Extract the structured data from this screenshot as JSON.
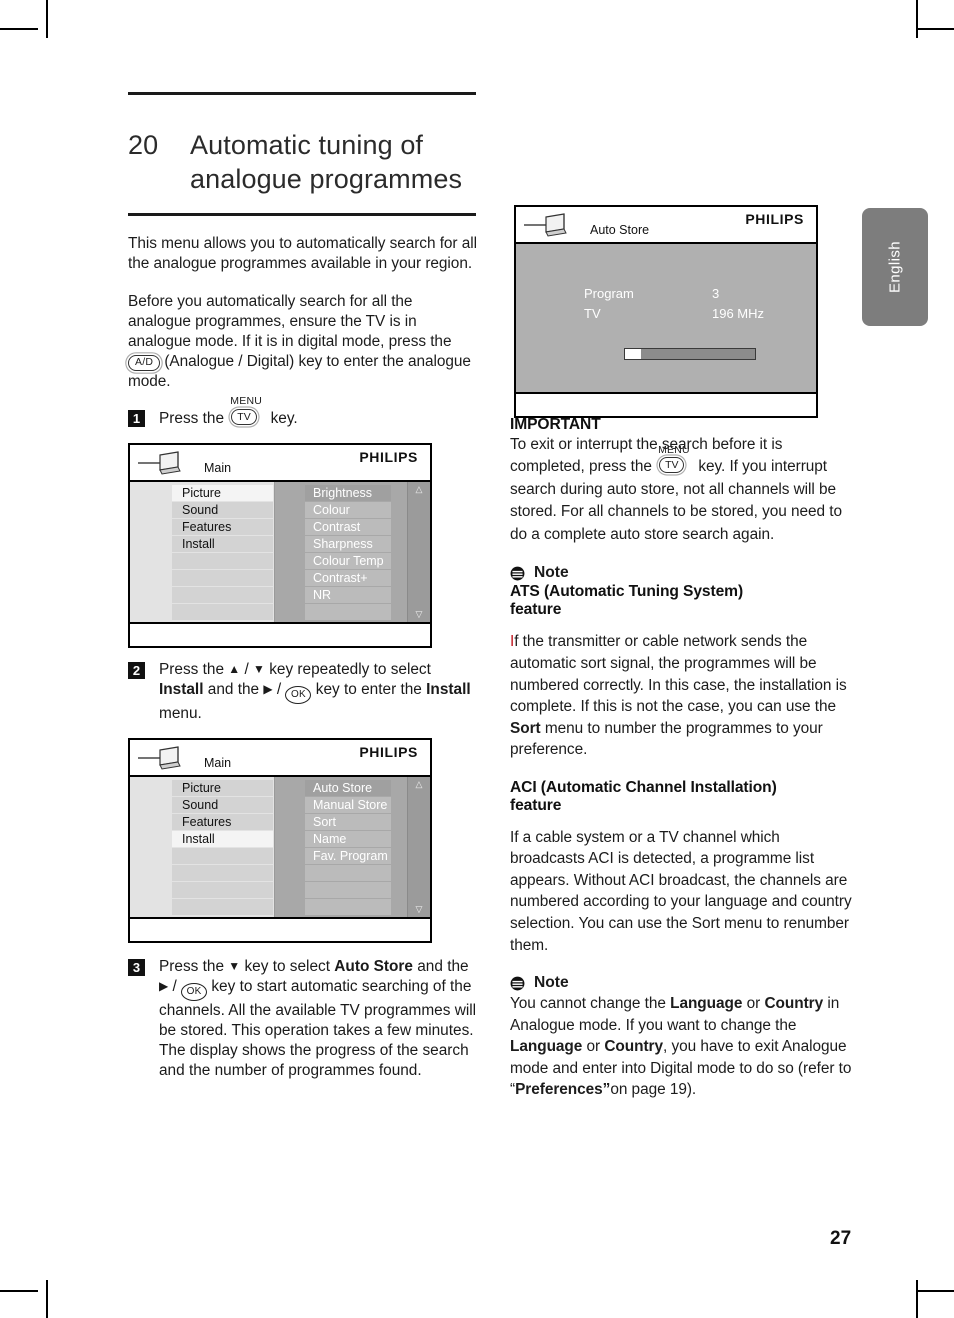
{
  "document": {
    "page_number": "27",
    "language_tab": "English",
    "brand": "PHILIPS"
  },
  "chapter": {
    "number": "20",
    "title_line1": "Automatic tuning of",
    "title_line2": "analogue programmes"
  },
  "left_column": {
    "intro": "This menu allows you to automatically search for all the analogue programmes available in your region.",
    "before_part1": "Before you automatically search for all the analogue programmes, ensure the TV is in analogue mode. If it is in digital mode, press the",
    "before_key": "A/D",
    "before_part2": "(Analogue / Digital) key to enter the analogue mode.",
    "step1": {
      "number": "1",
      "text_before": "Press the",
      "key_label": "TV",
      "key_top_label": "MENU",
      "text_after": "key."
    },
    "step2": {
      "number": "2",
      "line1_a": "Press the",
      "arrow_up": "▲",
      "arrow_slash": "/",
      "arrow_down": "▼",
      "line1_b": "key repeatedly to",
      "line2_a": "select",
      "bold1": "Install",
      "line2_b": "and the",
      "arrow_right": "▶",
      "ok_key": "OK",
      "line2_c": "key to",
      "line3_a": "enter the",
      "bold2": "Install",
      "line3_b": "menu."
    },
    "step3": {
      "number": "3",
      "line_a": "Press the",
      "arrow_down": "▼",
      "line_b": "key to select",
      "bold1": "Auto Store",
      "line_c": "and the",
      "arrow_right": "▶",
      "ok_key": "OK",
      "line_d": "key to start automatic searching of the channels. All the available TV programmes will be stored. This operation takes a few minutes. The display shows the progress of the search and the number of programmes found."
    }
  },
  "osd_main": {
    "brand": "PHILIPS",
    "title": "Main",
    "left_items": [
      {
        "label": "Picture",
        "selected": true
      },
      {
        "label": "Sound",
        "selected": false
      },
      {
        "label": "Features",
        "selected": false
      },
      {
        "label": "Install",
        "selected": false
      },
      {
        "label": "",
        "selected": false
      },
      {
        "label": "",
        "selected": false
      },
      {
        "label": "",
        "selected": false
      },
      {
        "label": "",
        "selected": false
      }
    ],
    "right_items": [
      {
        "label": "Brightness",
        "selected": true
      },
      {
        "label": "Colour",
        "selected": false
      },
      {
        "label": "Contrast",
        "selected": false
      },
      {
        "label": "Sharpness",
        "selected": false
      },
      {
        "label": "Colour Temp",
        "selected": false
      },
      {
        "label": "Contrast+",
        "selected": false
      },
      {
        "label": "NR",
        "selected": false
      },
      {
        "label": "",
        "selected": false
      }
    ],
    "scroll_up": "△",
    "scroll_down": "▽"
  },
  "osd_install": {
    "brand": "PHILIPS",
    "title": "Main",
    "left_items": [
      {
        "label": "Picture",
        "selected": false
      },
      {
        "label": "Sound",
        "selected": false
      },
      {
        "label": "Features",
        "selected": false
      },
      {
        "label": "Install",
        "selected": true
      },
      {
        "label": "",
        "selected": false
      },
      {
        "label": "",
        "selected": false
      },
      {
        "label": "",
        "selected": false
      },
      {
        "label": "",
        "selected": false
      }
    ],
    "right_items": [
      {
        "label": "Auto Store",
        "selected": true
      },
      {
        "label": "Manual Store",
        "selected": false
      },
      {
        "label": "Sort",
        "selected": false
      },
      {
        "label": "Name",
        "selected": false
      },
      {
        "label": "Fav. Program",
        "selected": false
      },
      {
        "label": "",
        "selected": false
      },
      {
        "label": "",
        "selected": false
      },
      {
        "label": "",
        "selected": false
      }
    ],
    "scroll_up": "△",
    "scroll_down": "▽"
  },
  "osd_autostore": {
    "brand": "PHILIPS",
    "title": "Auto Store",
    "row1_label": "Program",
    "row1_value": "3",
    "row2_label": "TV",
    "row2_value": "196 MHz",
    "progress_percent": 12
  },
  "right_column": {
    "important": {
      "heading": "IMPORTANT",
      "part1": "To exit or interrupt the search before it is completed, press the",
      "key_label": "TV",
      "key_top_label": "MENU",
      "part2": "key. If you interrupt search during auto store, not all channels will be stored. For all channels to be stored, you need to do a complete auto store search again."
    },
    "note_ats": {
      "note_word": "Note",
      "heading_line1": "ATS (Automatic Tuning System)",
      "heading_line2": "feature",
      "body_cap": "I",
      "body_a": "f the transmitter or cable network sends the automatic sort signal, the programmes will be numbered correctly. In this case, the installation is complete. If this is not the case, you can use the",
      "bold1": "Sort",
      "body_b": "menu to number the programmes to your preference."
    },
    "aci": {
      "heading_line1": "ACI (Automatic Channel Installation)",
      "heading_line2": "feature",
      "body": "If a cable system or a TV channel which broadcasts ACI is detected, a programme list appears. Without ACI broadcast, the channels are numbered according to your language and country selection. You can use the Sort menu to renumber them."
    },
    "note_lang": {
      "note_word": "Note",
      "a": "You cannot change the",
      "bold1": "Language",
      "b": "or",
      "bold2": "Country",
      "c": "in Analogue mode. If you want to change the",
      "bold3": "Language",
      "d": "or",
      "bold4": "Country",
      "e": ", you have to exit Analogue mode and enter into Digital mode to do so (refer to",
      "quote_open": "“",
      "bold5": "Preferences”",
      "f": "on page 19)."
    }
  },
  "colors": {
    "accent_red": "#c01820",
    "osd_panel_left": "#e3e3e3",
    "osd_panel_right": "#a8a8a8",
    "lang_tab_bg": "#7d7d7d"
  }
}
